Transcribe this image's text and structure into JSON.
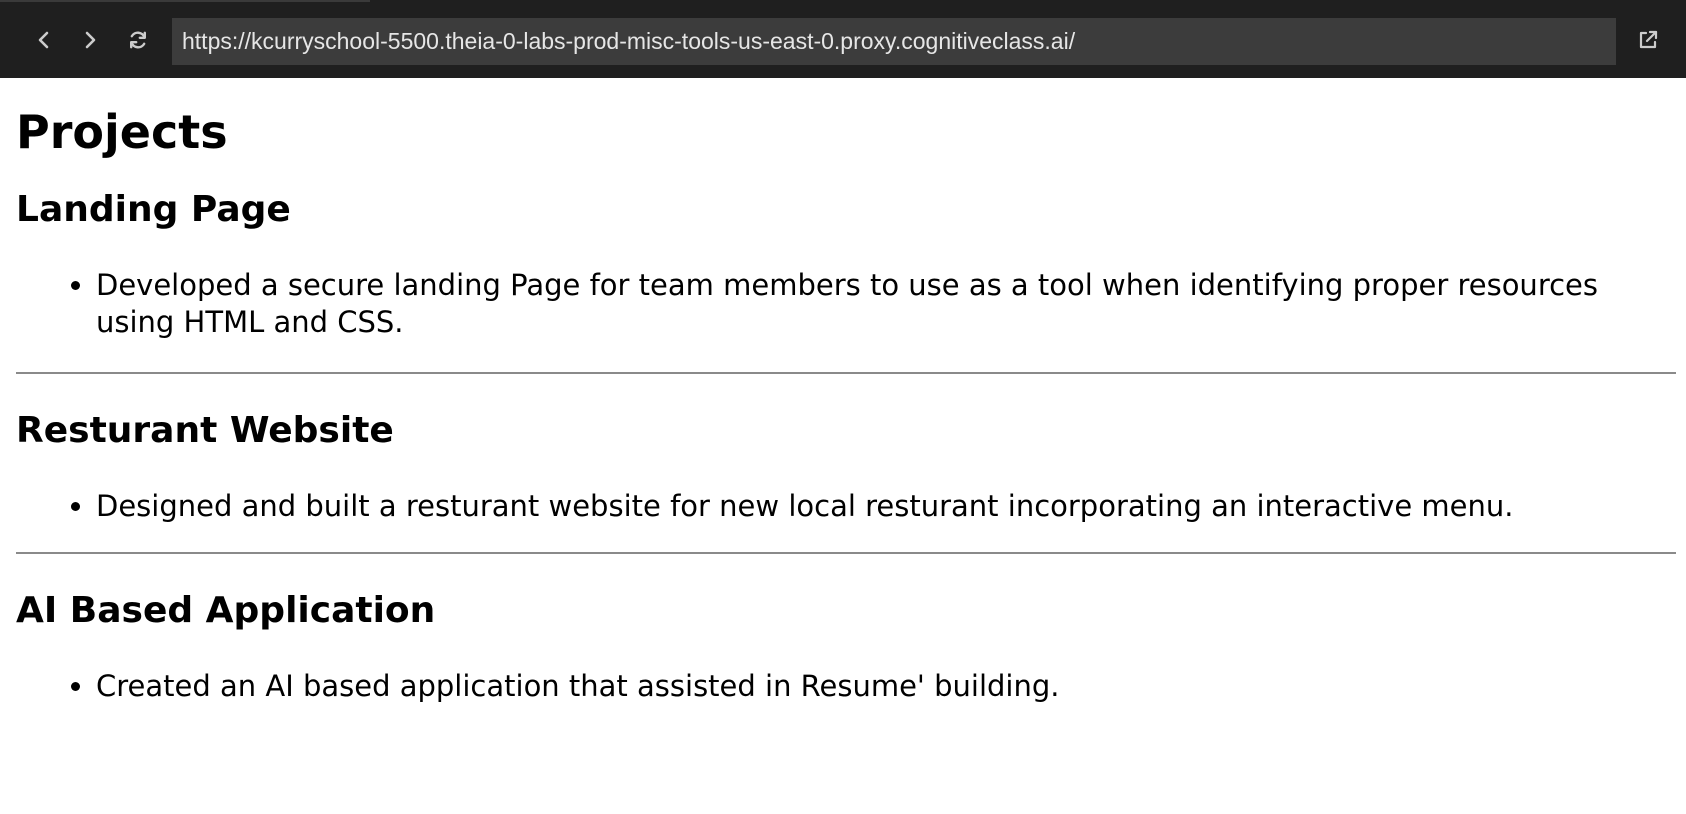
{
  "browser": {
    "url": "https://kcurryschool-5500.theia-0-labs-prod-misc-tools-us-east-0.proxy.cognitiveclass.ai/",
    "icons": {
      "back": "chevron-left-icon",
      "forward": "chevron-right-icon",
      "reload": "refresh-icon",
      "open_external": "external-link-icon"
    },
    "colors": {
      "toolbar_bg": "#1f1f1f",
      "url_bg": "#3c3c3c",
      "url_text": "#e6e6e6",
      "icon": "#cccccc"
    }
  },
  "page": {
    "title": "Projects",
    "projects": [
      {
        "heading": "Landing Page",
        "items": [
          "Developed a secure landing Page for team members to use as a tool when identifying proper resources using HTML and CSS."
        ]
      },
      {
        "heading": "Resturant Website",
        "items": [
          "Designed and built a resturant website for new local resturant incorporating an interactive menu."
        ]
      },
      {
        "heading": "AI Based Application",
        "items": [
          "Created an AI based application that assisted in Resume' building."
        ]
      }
    ]
  }
}
